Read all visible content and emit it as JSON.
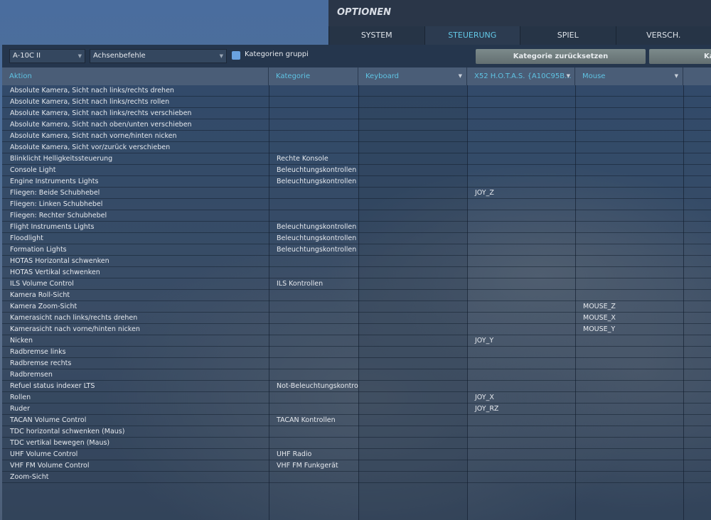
{
  "title": "OPTIONEN",
  "tabs": [
    "SYSTEM",
    "STEUERUNG",
    "SPIEL",
    "VERSCH."
  ],
  "toolbar": {
    "aircraft": "A-10C II",
    "mode": "Achsenbefehle",
    "group_label": "Kategorien gruppi",
    "reset_category": "Kategorie zurücksetzen",
    "reset_other": "Ka"
  },
  "columns": [
    "Aktion",
    "Kategorie",
    "Keyboard",
    "X52 H.O.T.A.S. {A10C95B...",
    "Mouse"
  ],
  "rows": [
    [
      "Absolute Kamera, Sicht nach links/rechts drehen",
      "",
      "",
      ""
    ],
    [
      "Absolute Kamera, Sicht nach links/rechts rollen",
      "",
      "",
      ""
    ],
    [
      "Absolute Kamera, Sicht nach links/rechts verschieben",
      "",
      "",
      ""
    ],
    [
      "Absolute Kamera, Sicht nach oben/unten verschieben",
      "",
      "",
      ""
    ],
    [
      "Absolute Kamera, Sicht nach vorne/hinten nicken",
      "",
      "",
      ""
    ],
    [
      "Absolute Kamera, Sicht vor/zurück verschieben",
      "",
      "",
      ""
    ],
    [
      "Blinklicht Helligkeitssteuerung",
      "Rechte Konsole",
      "",
      ""
    ],
    [
      "Console Light",
      "Beleuchtungskontrollen",
      "",
      ""
    ],
    [
      "Engine Instruments Lights",
      "Beleuchtungskontrollen",
      "",
      ""
    ],
    [
      "Fliegen: Beide Schubhebel",
      "",
      "JOY_Z",
      ""
    ],
    [
      "Fliegen: Linken Schubhebel",
      "",
      "",
      ""
    ],
    [
      "Fliegen: Rechter Schubhebel",
      "",
      "",
      ""
    ],
    [
      "Flight Instruments Lights",
      "Beleuchtungskontrollen",
      "",
      ""
    ],
    [
      "Floodlight",
      "Beleuchtungskontrollen",
      "",
      ""
    ],
    [
      "Formation Lights",
      "Beleuchtungskontrollen",
      "",
      ""
    ],
    [
      "HOTAS Horizontal schwenken",
      "",
      "",
      ""
    ],
    [
      "HOTAS Vertikal schwenken",
      "",
      "",
      ""
    ],
    [
      "ILS Volume Control",
      "ILS Kontrollen",
      "",
      ""
    ],
    [
      "Kamera Roll-Sicht",
      "",
      "",
      ""
    ],
    [
      "Kamera Zoom-Sicht",
      "",
      "",
      "MOUSE_Z"
    ],
    [
      "Kamerasicht nach links/rechts drehen",
      "",
      "",
      "MOUSE_X"
    ],
    [
      "Kamerasicht nach vorne/hinten nicken",
      "",
      "",
      "MOUSE_Y"
    ],
    [
      "Nicken",
      "",
      "JOY_Y",
      ""
    ],
    [
      "Radbremse links",
      "",
      "",
      ""
    ],
    [
      "Radbremse rechts",
      "",
      "",
      ""
    ],
    [
      "Radbremsen",
      "",
      "",
      ""
    ],
    [
      "Refuel status indexer LTS",
      "Not-Beleuchtungskontrolle",
      "",
      ""
    ],
    [
      "Rollen",
      "",
      "JOY_X",
      ""
    ],
    [
      "Ruder",
      "",
      "JOY_RZ",
      ""
    ],
    [
      "TACAN Volume Control",
      "TACAN Kontrollen",
      "",
      ""
    ],
    [
      "TDC horizontal schwenken (Maus)",
      "",
      "",
      ""
    ],
    [
      "TDC vertikal bewegen (Maus)",
      "",
      "",
      ""
    ],
    [
      "UHF Volume Control",
      "UHF Radio",
      "",
      ""
    ],
    [
      "VHF FM Volume Control",
      "VHF FM Funkgerät",
      "",
      ""
    ],
    [
      "Zoom-Sicht",
      "",
      "",
      ""
    ]
  ]
}
